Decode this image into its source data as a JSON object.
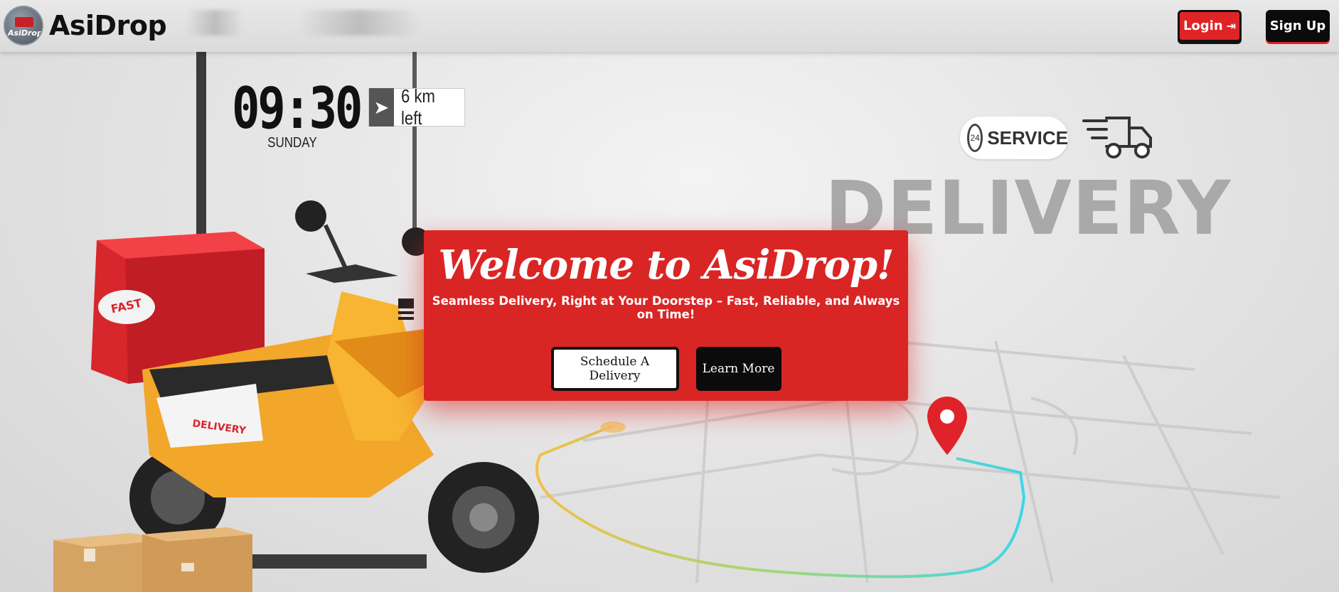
{
  "header": {
    "brand_name": "AsiDrop",
    "logo_text": "AsiDrop",
    "login_label": "Login",
    "signup_label": "Sign Up"
  },
  "hero_art": {
    "clock_time": "09:30",
    "clock_day": "SUNDAY",
    "distance_text": "6 km left",
    "service_label": "SERVICE",
    "service_hours": "24",
    "delivery_word": "DELIVERY",
    "box_label": "FAST",
    "scooter_label": "DELIVERY"
  },
  "hero": {
    "title": "Welcome to AsiDrop!",
    "subtitle": "Seamless Delivery, Right at Your Doorstep – Fast, Reliable, and Always on Time!",
    "primary_cta": "Schedule A Delivery",
    "secondary_cta": "Learn More"
  },
  "colors": {
    "brand_red": "#da2525",
    "button_black": "#0b0b0b",
    "background": "#e6e5e5"
  },
  "icons": {
    "login": "login-arrow-icon",
    "navigation": "navigation-arrow-icon",
    "service": "clock-24-icon",
    "truck": "delivery-truck-icon",
    "pin": "map-pin-icon"
  }
}
